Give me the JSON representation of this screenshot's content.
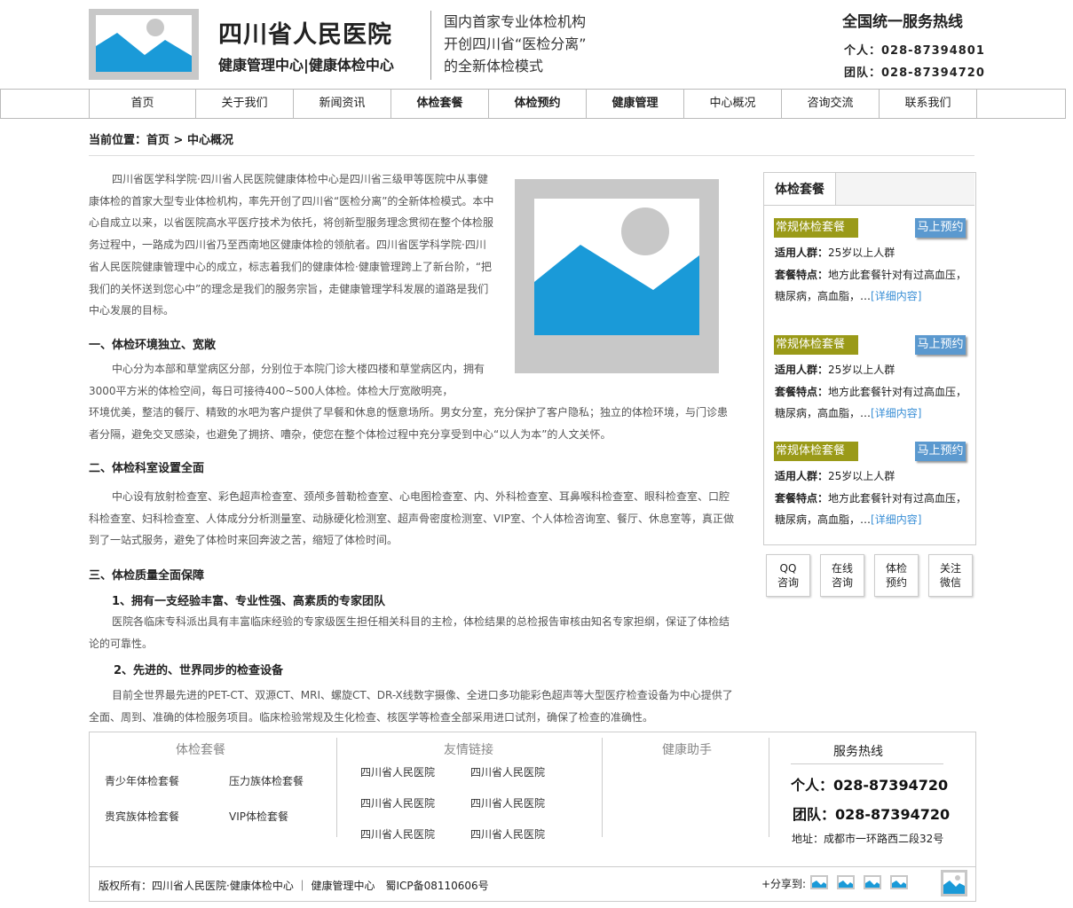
{
  "header": {
    "hospital_name": "四川省人民医院",
    "hospital_subtitle": "健康管理中心|健康体检中心",
    "slogan": [
      "国内首家专业体检机构",
      "开创四川省“医检分离”",
      "的全新体检模式"
    ],
    "hotline_title": "全国统一服务热线",
    "hotline_personal": "个人：028-87394801",
    "hotline_team": "团队：028-87394720"
  },
  "nav": {
    "items": [
      {
        "label": "首页"
      },
      {
        "label": "关于我们"
      },
      {
        "label": "新闻资讯"
      },
      {
        "label": "体检套餐"
      },
      {
        "label": "体检预约"
      },
      {
        "label": "健康管理"
      },
      {
        "label": "中心概况"
      },
      {
        "label": "咨询交流"
      },
      {
        "label": "联系我们"
      }
    ]
  },
  "breadcrumb": "当前位置：首页 > 中心概况",
  "article": {
    "intro": "四川省医学科学院·四川省人民医院健康体检中心是四川省三级甲等医院中从事健康体检的首家大型专业体检机构，率先开创了四川省“医检分离”的全新体检模式。本中心自成立以来，以省医院高水平医疗技术为依托，将创新型服务理念贯彻在整个体检服务过程中，一路成为四川省乃至西南地区健康体检的领航者。四川省医学科学院·四川省人民医院健康管理中心的成立，标志着我们的健康体检·健康管理跨上了新台阶，“把我们的关怀送到您心中”的理念是我们的服务宗旨，走健康管理学科发展的道路是我们中心发展的目标。",
    "h1": "一、体检环境独立、宽敞",
    "p1a": "中心分为本部和草堂病区分部，分别位于本院门诊大楼四楼和草堂病区内，拥有3000平方米的体检空间，每日可接待400~500人体检。体检大厅宽敞明亮，",
    "p1b": "环境优美，整洁的餐厅、精致的水吧为客户提供了早餐和休息的惬意场所。男女分室，充分保护了客户隐私；独立的体检环境，与门诊患者分隔，避免交叉感染，也避免了拥挤、嘈杂，使您在整个体检过程中充分享受到中心“以人为本”的人文关怀。",
    "h2": "二、体检科室设置全面",
    "p2": "中心设有放射检查室、彩色超声检查室、颈颅多普勒检查室、心电图检查室、内、外科检查室、耳鼻喉科检查室、眼科检查室、口腔科检查室、妇科检查室、人体成分分析测量室、动脉硬化检测室、超声骨密度检测室、VIP室、个人体检咨询室、餐厅、休息室等，真正做到了一站式服务，避免了体检时来回奔波之苦，缩短了体检时间。",
    "h3": "三、体检质量全面保障",
    "sh1": "1、拥有一支经验丰富、专业性强、高素质的专家团队",
    "p3": "医院各临床专科派出具有丰富临床经验的专家级医生担任相关科目的主检，体检结果的总检报告审核由知名专家担纲，保证了体检结论的可靠性。",
    "sh2": "2、先进的、世界同步的检查设备",
    "p4": "目前全世界最先进的PET-CT、双源CT、MRI、螺旋CT、DR-X线数字摄像、全进口多功能彩色超声等大型医疗检查设备为中心提供了全面、周到、准确的体检服务项目。临床检验常规及生化检查、核医学等检查全部采用进口试剂，确保了检查的准确性。"
  },
  "sidebar": {
    "tab": "体检套餐",
    "packages": [
      {
        "name": "常规体检套餐",
        "book": "马上预约",
        "crowd_label": "适用人群：",
        "crowd": "25岁以上人群",
        "feature_label": "套餐特点：",
        "feature": "地方此套餐针对有过高血压，糖尿病，高血脂，…",
        "more": "[详细内容]"
      },
      {
        "name": "常规体检套餐",
        "book": "马上预约",
        "crowd_label": "适用人群：",
        "crowd": "25岁以上人群",
        "feature_label": "套餐特点：",
        "feature": "地方此套餐针对有过高血压，糖尿病，高血脂，…",
        "more": "[详细内容]"
      },
      {
        "name": "常规体检套餐",
        "book": "马上预约",
        "crowd_label": "适用人群：",
        "crowd": "25岁以上人群",
        "feature_label": "套餐特点：",
        "feature": "地方此套餐针对有过高血压，糖尿病，高血脂，…",
        "more": "[详细内容]"
      }
    ],
    "quick": [
      {
        "l1": "QQ",
        "l2": "咨询"
      },
      {
        "l1": "在线",
        "l2": "咨询"
      },
      {
        "l1": "体检",
        "l2": "预约"
      },
      {
        "l1": "关注",
        "l2": "微信"
      }
    ]
  },
  "footer": {
    "col1_title": "体检套餐",
    "col1_links": [
      "青少年体检套餐",
      "压力族体检套餐",
      "贵宾族体检套餐",
      "VIP体检套餐"
    ],
    "col2_title": "友情链接",
    "col2_links": [
      "四川省人民医院",
      "四川省人民医院",
      "四川省人民医院",
      "四川省人民医院",
      "四川省人民医院",
      "四川省人民医院"
    ],
    "col3_title": "健康助手",
    "col4_title": "服务热线",
    "personal": "个人：028-87394720",
    "team": "团队：028-87394720",
    "address": "地址：成都市一环路西二段32号",
    "copyright": "版权所有：四川省人民医院·健康体检中心 ｜ 健康管理中心　蜀ICP备08110606号",
    "share_label": "+分享到:"
  },
  "colors": {
    "accent_blue": "#1a9ad8",
    "placeholder_gray": "#c8c8c8",
    "tag_olive": "#9a9a18",
    "button_blue": "#5b99cf"
  },
  "icons": [
    "logo-placeholder-image",
    "article-placeholder-image",
    "share-icon",
    "footer-placeholder-image"
  ]
}
